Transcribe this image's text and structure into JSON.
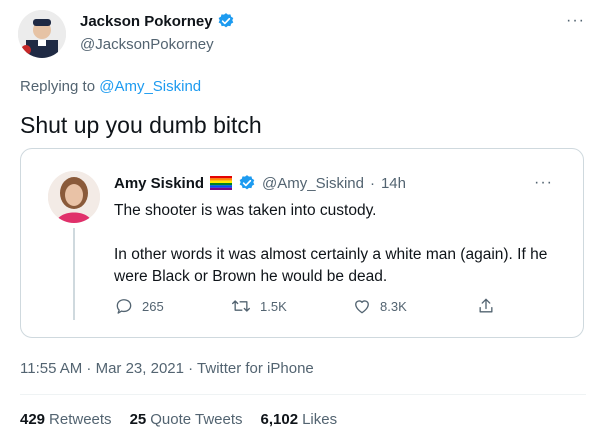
{
  "author": {
    "name": "Jackson Pokorney",
    "handle": "@JacksonPokorney",
    "more_icon": "more-icon"
  },
  "reply": {
    "prefix": "Replying to",
    "to": "@Amy_Siskind"
  },
  "tweet": {
    "text": "Shut up you dumb bitch"
  },
  "quote": {
    "name": "Amy Siskind",
    "handle": "@Amy_Siskind",
    "separator": "·",
    "time": "14h",
    "line1": "The shooter is was taken into custody.",
    "line2": "In other words it was almost certainly a white man (again).  If he were Black or Brown he would be dead.",
    "replies": "265",
    "retweets": "1.5K",
    "likes": "8.3K"
  },
  "meta": "11:55 AM · Mar 23, 2021 · Twitter for iPhone",
  "stats": {
    "retweets_count": "429",
    "retweets_label": "Retweets",
    "quotes_count": "25",
    "quotes_label": "Quote Tweets",
    "likes_count": "6,102",
    "likes_label": "Likes"
  },
  "colors": {
    "accent": "#1d9bf0",
    "secondary_text": "#536471",
    "border": "#cfd9de"
  }
}
